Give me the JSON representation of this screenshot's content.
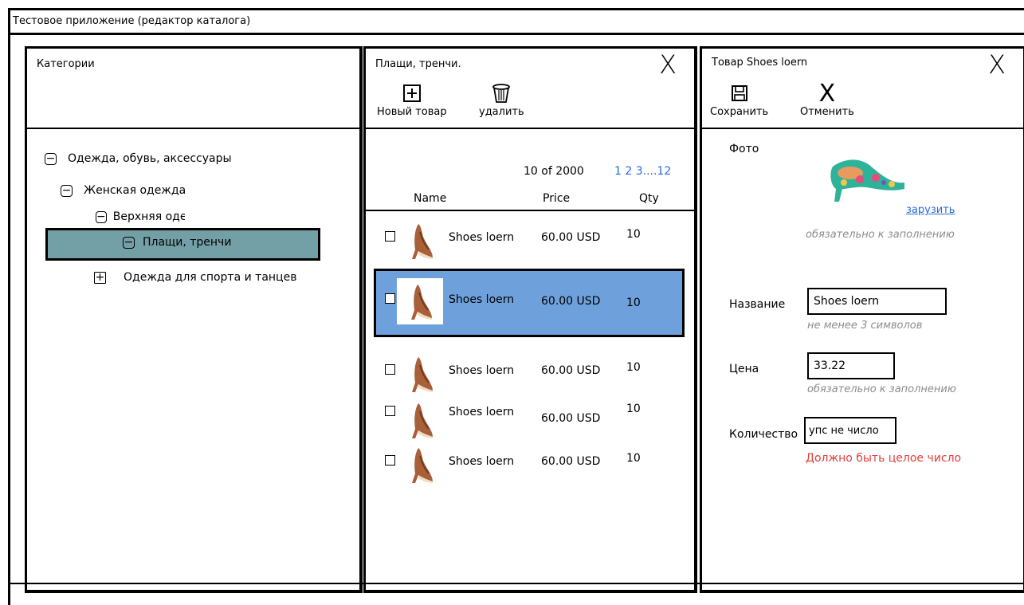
{
  "window": {
    "title": "Тестовое приложение (редактор каталога)"
  },
  "categories": {
    "title": "Категории",
    "tree": [
      {
        "toggle": "−",
        "label": "Одежда, обувь, аксессуары"
      },
      {
        "toggle": "−",
        "label": "Женская одежда"
      },
      {
        "toggle": "−",
        "label": "Верхняя одежда"
      },
      {
        "toggle": "−",
        "label": "Плащи, тренчи",
        "selected": true
      },
      {
        "toggle": "+",
        "label": "Одежда для спорта и танцев"
      }
    ]
  },
  "list": {
    "title": "Плащи, тренчи.",
    "close": "X",
    "toolbar": {
      "new_label": "Новый товар",
      "delete_label": "удалить"
    },
    "pager": {
      "text": "10 of 2000",
      "links": "1 2 3....12"
    },
    "columns": {
      "name": "Name",
      "price": "Price",
      "qty": "Qty"
    },
    "rows": [
      {
        "name": "Shoes loern",
        "price": "60.00 USD",
        "qty": "10",
        "checked": false
      },
      {
        "name": "Shoes loern",
        "price": "60.00 USD",
        "qty": "10",
        "checked": false,
        "selected": true
      },
      {
        "name": "Shoes loern",
        "price": "60.00 USD",
        "qty": "10",
        "checked": false
      },
      {
        "name": "Shoes loern",
        "price": "60.00 USD",
        "qty": "10",
        "checked": false
      },
      {
        "name": "Shoes loern",
        "price": "60.00 USD",
        "qty": "10",
        "checked": false
      }
    ]
  },
  "editor": {
    "title": "Товар Shoes loern",
    "close": "X",
    "toolbar": {
      "save_label": "Сохранить",
      "cancel_label": "Отменить"
    },
    "photo": {
      "label": "Фото",
      "upload_link": "зарузить",
      "hint": "обязательно к заполнению"
    },
    "name": {
      "label": "Название",
      "value": "Shoes loern",
      "hint": "не менее 3 символов"
    },
    "price": {
      "label": "Цена",
      "value": "33.22",
      "hint": "обязательно к заполнению"
    },
    "quantity": {
      "label": "Количество",
      "value": "упс не число",
      "error": "Должно быть целое число"
    },
    "colors": {
      "error": "#e23c3c",
      "link": "#2a6ad6",
      "row_selected": "#6ea1dc",
      "tree_selected": "#739fa6"
    }
  }
}
